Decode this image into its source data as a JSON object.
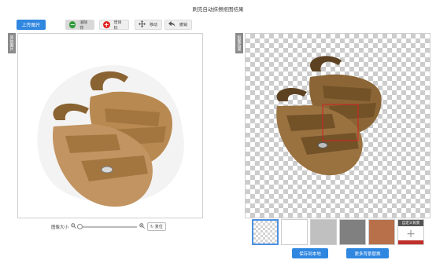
{
  "header": {
    "title": "刷完自动抹擦抠图结果"
  },
  "toolbar": {
    "upload_label": "上传图片",
    "tools": [
      {
        "label": "消除背",
        "icon": "minus-circle-icon",
        "color": "#2e9b3a"
      },
      {
        "label": "增目标",
        "icon": "plus-circle-icon",
        "color": "#e02020"
      },
      {
        "label": "移动",
        "icon": "move-icon",
        "color": "#555555"
      },
      {
        "label": "撤销",
        "icon": "undo-icon",
        "color": "#555555"
      }
    ]
  },
  "left_panel": {
    "side_label": "原始图片"
  },
  "right_panel": {
    "side_label": "抠图结果"
  },
  "zoom": {
    "label": "图像大小",
    "reset_label": "复位"
  },
  "backgrounds": {
    "swatches": [
      {
        "type": "transparent",
        "color": ""
      },
      {
        "type": "color",
        "color": "#ffffff"
      },
      {
        "type": "color",
        "color": "#c0c0c0"
      },
      {
        "type": "color",
        "color": "#808080"
      },
      {
        "type": "color",
        "color": "#b8704a"
      }
    ],
    "custom_label": "自定义背景",
    "custom_bar_color": "#c0302a"
  },
  "actions": {
    "save_label": "保存到本地",
    "more_label": "更多背景替换"
  },
  "colors": {
    "accent": "#2f87e0",
    "selection_box": "#d42020"
  }
}
